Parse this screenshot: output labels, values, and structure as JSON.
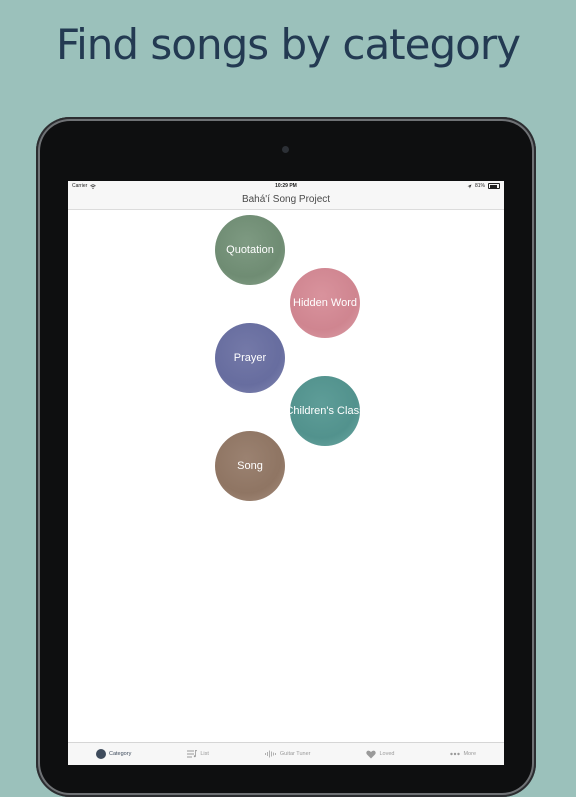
{
  "headline": "Find songs by category",
  "status": {
    "carrier": "Carrier",
    "time": "10:29 PM",
    "battery": "81%"
  },
  "nav": {
    "title": "Bahá'í Song Project"
  },
  "categories": [
    {
      "label": "Quotation",
      "color": "#7e9a82"
    },
    {
      "label": "Hidden Word",
      "color": "#d9939d"
    },
    {
      "label": "Prayer",
      "color": "#7479a8"
    },
    {
      "label": "Children's Class",
      "color": "#5e9d98"
    },
    {
      "label": "Song",
      "color": "#9b8271"
    }
  ],
  "tabs": [
    {
      "label": "Category",
      "icon": "circle-icon",
      "active": true
    },
    {
      "label": "List",
      "icon": "list-icon"
    },
    {
      "label": "Guitar Tuner",
      "icon": "waveform-icon"
    },
    {
      "label": "Loved",
      "icon": "heart-icon"
    },
    {
      "label": "More",
      "icon": "more-icon"
    }
  ],
  "colors": {
    "background": "#9bc1bb",
    "headline": "#233a52",
    "active_tab": "#3e4b5c",
    "inactive_tab": "#9a9a9a"
  }
}
